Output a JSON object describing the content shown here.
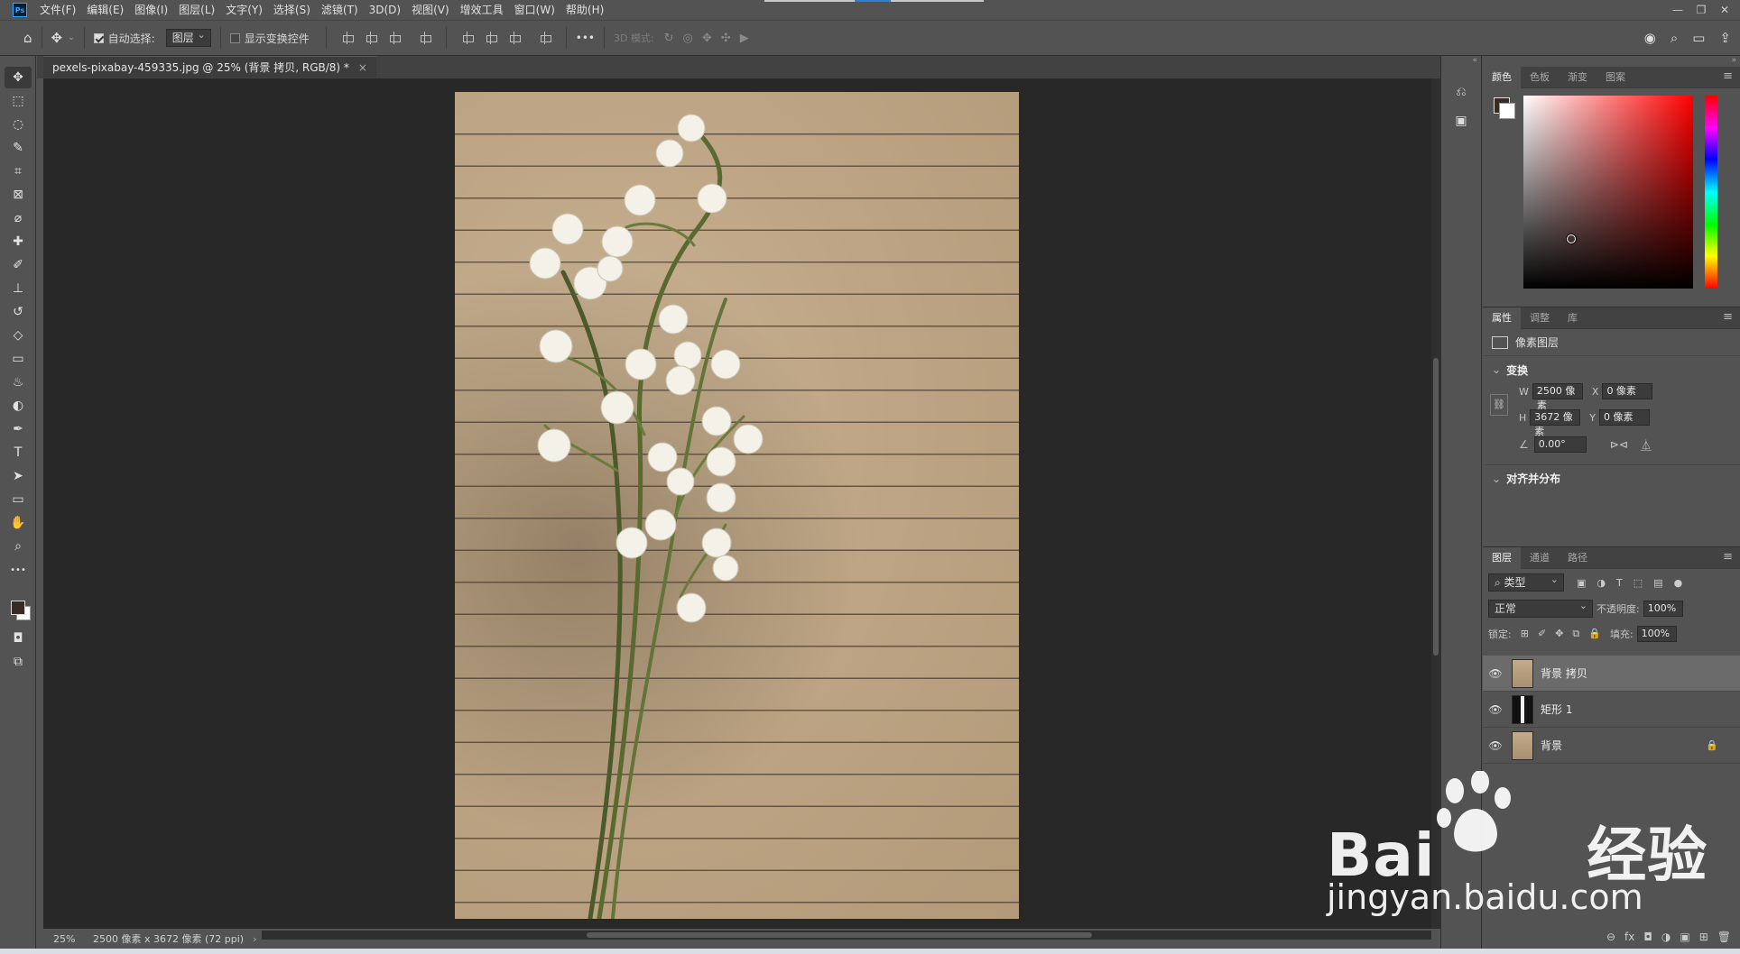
{
  "app": {
    "logo_text": "Ps",
    "menu": [
      "文件(F)",
      "编辑(E)",
      "图像(I)",
      "图层(L)",
      "文字(Y)",
      "选择(S)",
      "滤镜(T)",
      "3D(D)",
      "视图(V)",
      "增效工具",
      "窗口(W)",
      "帮助(H)"
    ],
    "window_controls": [
      "—",
      "❐",
      "✕"
    ]
  },
  "options": {
    "auto_select_label": "自动选择:",
    "auto_select_target": "图层",
    "show_transform_label": "显示变换控件",
    "more": "•••",
    "mode_3d_label": "3D 模式:"
  },
  "document": {
    "tab_title": "pexels-pixabay-459335.jpg @ 25% (背景 拷贝, RGB/8) *",
    "tab_close": "×",
    "zoom": "25%",
    "dimensions": "2500 像素 x 3672 像素 (72 ppi)",
    "status_arrow": "›"
  },
  "tools": [
    {
      "name": "move-tool",
      "glyph": "✥"
    },
    {
      "name": "marquee-tool",
      "glyph": "⬚"
    },
    {
      "name": "lasso-tool",
      "glyph": "◌"
    },
    {
      "name": "quick-select-tool",
      "glyph": "✎"
    },
    {
      "name": "crop-tool",
      "glyph": "⌗"
    },
    {
      "name": "frame-tool",
      "glyph": "⊠"
    },
    {
      "name": "eyedropper-tool",
      "glyph": "⌀"
    },
    {
      "name": "healing-tool",
      "glyph": "✚"
    },
    {
      "name": "brush-tool",
      "glyph": "✐"
    },
    {
      "name": "stamp-tool",
      "glyph": "⊥"
    },
    {
      "name": "history-brush-tool",
      "glyph": "↺"
    },
    {
      "name": "eraser-tool",
      "glyph": "◇"
    },
    {
      "name": "gradient-tool",
      "glyph": "▭"
    },
    {
      "name": "blur-tool",
      "glyph": "♨"
    },
    {
      "name": "dodge-tool",
      "glyph": "◐"
    },
    {
      "name": "pen-tool",
      "glyph": "✒"
    },
    {
      "name": "type-tool",
      "glyph": "T"
    },
    {
      "name": "path-select-tool",
      "glyph": "➤"
    },
    {
      "name": "shape-tool",
      "glyph": "▭"
    },
    {
      "name": "hand-tool",
      "glyph": "✋"
    },
    {
      "name": "zoom-tool",
      "glyph": "⌕"
    },
    {
      "name": "more-tools",
      "glyph": "•••"
    }
  ],
  "color_panel": {
    "tabs": [
      "颜色",
      "色板",
      "渐变",
      "图案"
    ],
    "foreground": "#3a2a24",
    "background": "#ffffff"
  },
  "properties_panel": {
    "tabs": [
      "属性",
      "调整",
      "库"
    ],
    "layer_type": "像素图层",
    "transform_title": "变换",
    "w_label": "W",
    "w_value": "2500 像素",
    "x_label": "X",
    "x_value": "0 像素",
    "h_label": "H",
    "h_value": "3672 像素",
    "y_label": "Y",
    "y_value": "0 像素",
    "angle_value": "0.00°",
    "align_title": "对齐并分布"
  },
  "layers_panel": {
    "tabs": [
      "图层",
      "通道",
      "路径"
    ],
    "filter_kind": "类型",
    "blend_mode": "正常",
    "opacity_label": "不透明度:",
    "opacity_value": "100%",
    "lock_label": "锁定:",
    "fill_label": "填充:",
    "fill_value": "100%",
    "layers": [
      {
        "name": "背景 拷贝",
        "selected": true,
        "locked": false,
        "thumb": "photo"
      },
      {
        "name": "矩形 1",
        "selected": false,
        "locked": false,
        "thumb": "mask"
      },
      {
        "name": "背景",
        "selected": false,
        "locked": true,
        "thumb": "photo"
      }
    ],
    "footer_icons": [
      "⊖",
      "fx",
      "◘",
      "◑",
      "▣",
      "⊞",
      "🗑"
    ]
  },
  "watermark": {
    "logo_text": "Bai du 经验",
    "url_text": "jingyan.baidu.com"
  }
}
